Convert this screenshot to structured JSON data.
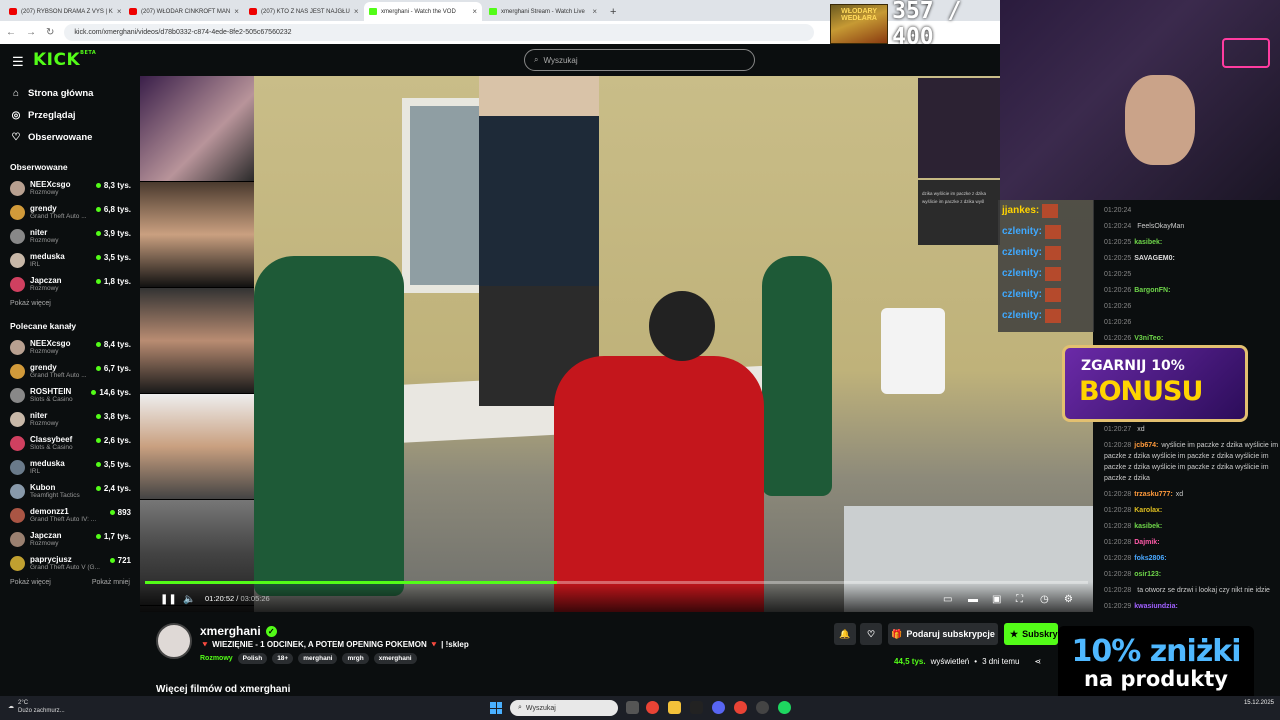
{
  "browser": {
    "tabs": [
      {
        "label": "(207) RYBSON DRAMA Z VYS | K",
        "icon": "youtube-icon",
        "active": false
      },
      {
        "label": "(207) WŁODAR CINKROFT MAN",
        "icon": "youtube-icon",
        "active": false
      },
      {
        "label": "(207) KTO Z NAS JEST NAJGŁU",
        "icon": "youtube-icon",
        "active": false
      },
      {
        "label": "xmerghani - Watch the VOD",
        "icon": "kick-icon",
        "active": true
      },
      {
        "label": "xmerghani Stream - Watch Live",
        "icon": "kick-icon",
        "active": false
      }
    ],
    "url": "kick.com/xmerghani/videos/d78b0332-c874-4ede-8fe2-505c67560232"
  },
  "overlay_counter": {
    "banner": "WŁODARY WEDŁARA",
    "text": "357 / 400"
  },
  "header": {
    "logo": "KICK",
    "logo_sup": "BETA",
    "search_placeholder": "Wyszukaj"
  },
  "sidebar": {
    "nav": [
      {
        "label": "Strona główna",
        "icon": "home-icon"
      },
      {
        "label": "Przeglądaj",
        "icon": "compass-icon"
      },
      {
        "label": "Obserwowane",
        "icon": "heart-icon"
      }
    ],
    "followed_title": "Obserwowane",
    "followed": [
      {
        "name": "NEEXcsgo",
        "category": "Rozmowy",
        "viewers": "8,3 tys."
      },
      {
        "name": "grendy",
        "category": "Grand Theft Auto ...",
        "viewers": "6,8 tys."
      },
      {
        "name": "niter",
        "category": "Rozmowy",
        "viewers": "3,9 tys."
      },
      {
        "name": "meduska",
        "category": "IRL",
        "viewers": "3,5 tys."
      },
      {
        "name": "Japczan",
        "category": "Rozmowy",
        "viewers": "1,8 tys."
      }
    ],
    "followed_more": "Pokaż więcej",
    "recommended_title": "Polecane kanały",
    "recommended": [
      {
        "name": "NEEXcsgo",
        "category": "Rozmowy",
        "viewers": "8,4 tys."
      },
      {
        "name": "grendy",
        "category": "Grand Theft Auto ...",
        "viewers": "6,7 tys."
      },
      {
        "name": "ROSHTEIN",
        "category": "Slots & Casino",
        "viewers": "14,6 tys."
      },
      {
        "name": "niter",
        "category": "Rozmowy",
        "viewers": "3,8 tys."
      },
      {
        "name": "Classybeef",
        "category": "Slots & Casino",
        "viewers": "2,6 tys."
      },
      {
        "name": "meduska",
        "category": "IRL",
        "viewers": "3,5 tys."
      },
      {
        "name": "Kubon",
        "category": "Teamfight Tactics",
        "viewers": "2,4 tys."
      },
      {
        "name": "demonzz1",
        "category": "Grand Theft Auto IV: ...",
        "viewers": "893"
      },
      {
        "name": "Japczan",
        "category": "Rozmowy",
        "viewers": "1,7 tys."
      },
      {
        "name": "paprycjusz",
        "category": "Grand Theft Auto V (G...",
        "viewers": "721"
      }
    ],
    "recommended_more": "Pokaż więcej",
    "recommended_less": "Pokaż mniej"
  },
  "player": {
    "current_time": "01:20:52",
    "duration": "03:05:26",
    "progress": 0.437
  },
  "overlay": {
    "chat_snippet": "dzika wyślicie im paczke z dzika wyślicie im paczke z dzika wyśl",
    "members": [
      "jjankes:",
      "czlenity:",
      "czlenity:",
      "czlenity:",
      "czlenity:",
      "czlenity:"
    ]
  },
  "chat": {
    "messages": [
      {
        "time": "01:20:24",
        "user": "",
        "text": "",
        "color": "#6fd64a"
      },
      {
        "time": "01:20:24",
        "user": "",
        "text": "FeelsOkayMan",
        "color": "#c94a4a"
      },
      {
        "time": "01:20:25",
        "user": "kasibek:",
        "text": "",
        "color": "#6fd64a"
      },
      {
        "time": "01:20:25",
        "user": "SAVAGEM0:",
        "text": "",
        "color": "#ddd"
      },
      {
        "time": "01:20:25",
        "user": "",
        "text": "",
        "color": "#c94a4a"
      },
      {
        "time": "01:20:26",
        "user": "BargonFN:",
        "text": "",
        "color": "#6fd64a"
      },
      {
        "time": "01:20:26",
        "user": "",
        "text": "",
        "color": "#a060ff"
      },
      {
        "time": "01:20:26",
        "user": "",
        "text": "",
        "color": "#a060ff"
      },
      {
        "time": "01:20:26",
        "user": "V3niTeo:",
        "text": "",
        "color": "#6fd64a"
      }
    ],
    "messages_lower": [
      {
        "time": "01:20:27",
        "user": "",
        "text": "xd",
        "color": "#c94a4a"
      },
      {
        "time": "01:20:28",
        "user": "jcb674:",
        "text": "wyślicie im paczke z dzika wyślicie im paczke z dzika wyślicie im paczke z dzika wyślicie im paczke z dzika wyślicie im paczke z dzika wyślicie im paczke z dzika",
        "color": "#ff9a3c"
      },
      {
        "time": "01:20:28",
        "user": "trzasku777:",
        "text": "xd",
        "color": "#ff9a3c"
      },
      {
        "time": "01:20:28",
        "user": "Karolax:",
        "text": "",
        "color": "#e0c020"
      },
      {
        "time": "01:20:28",
        "user": "kasibek:",
        "text": "",
        "color": "#6fd64a"
      },
      {
        "time": "01:20:28",
        "user": "Dajmik:",
        "text": "",
        "color": "#ff5aa8"
      },
      {
        "time": "01:20:28",
        "user": "foks2806:",
        "text": "",
        "color": "#4aa8ff"
      },
      {
        "time": "01:20:28",
        "user": "osir123:",
        "text": "",
        "color": "#6fd64a"
      },
      {
        "time": "01:20:28",
        "user": "",
        "text": "ta otworz se drzwi i lookaj czy nikt nie idzie",
        "color": "#c94a4a"
      },
      {
        "time": "01:20:29",
        "user": "kwasiundzia:",
        "text": "",
        "color": "#a060ff"
      }
    ]
  },
  "bonus_banner": {
    "line1": "ZGARNIJ 10%",
    "line2": "BONUSU"
  },
  "promo": {
    "line1": "10% zniżki",
    "line2": "na produkty"
  },
  "stream_info": {
    "streamer": "xmerghani",
    "title": "🔻 WIEZIĘNIE - 1 ODCINEK, A POTEM OPENING POKEMON 🔻 | !sklep",
    "category": "Rozmowy",
    "tags": [
      "Polish",
      "18+",
      "merghani",
      "mrgh",
      "xmerghani"
    ],
    "gift_label": "Podaruj subskrypcje",
    "subscribe_label": "Subskrybuj",
    "views_num": "44,5 tys.",
    "views_label": "wyświetleń",
    "age": "3 dni temu",
    "more_videos": "Więcej filmów od xmerghani"
  },
  "taskbar": {
    "temperature": "2°C",
    "weather": "Dużo zachmurz...",
    "search": "Wyszukaj",
    "date": "15.12.2025",
    "time": ""
  }
}
